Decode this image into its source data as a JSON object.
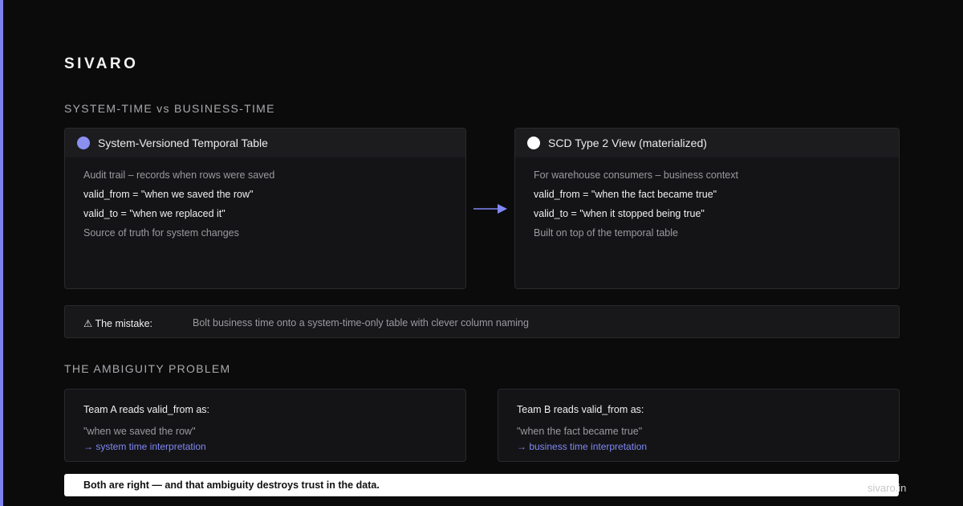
{
  "brand": "SIVARO",
  "section1": {
    "title": "SYSTEM-TIME vs BUSINESS-TIME",
    "left_card": {
      "title": "System-Versioned Temporal Table",
      "dot_color": "#8a8ff0",
      "lines": [
        "Audit trail – records when rows were saved",
        "valid_from = \"when we saved the row\"",
        "valid_to = \"when we replaced it\"",
        "Source of truth for system changes"
      ]
    },
    "right_card": {
      "title": "SCD Type 2 View (materialized)",
      "dot_color": "#ffffff",
      "lines": [
        "For warehouse consumers – business context",
        "valid_from = \"when the fact became true\"",
        "valid_to = \"when it stopped being true\"",
        "Built on top of the temporal table"
      ]
    },
    "arrow_color": "#8088f5"
  },
  "mistake": {
    "label": "⚠ The mistake:",
    "text": "Bolt business time onto a system-time-only table with clever column naming"
  },
  "section2": {
    "title": "THE AMBIGUITY PROBLEM",
    "team_a": {
      "heading": "Team A reads valid_from as:",
      "quote": "\"when we saved the row\"",
      "interpretation": "→ system time interpretation"
    },
    "team_b": {
      "heading": "Team B reads valid_from as:",
      "quote": "\"when the fact became true\"",
      "interpretation": "→ business time interpretation"
    }
  },
  "banner": "Both are right — and that ambiguity destroys trust in the data.",
  "footer": "sivaro.in",
  "colors": {
    "accent": "#7b82f0",
    "background": "#0b0b0c"
  }
}
